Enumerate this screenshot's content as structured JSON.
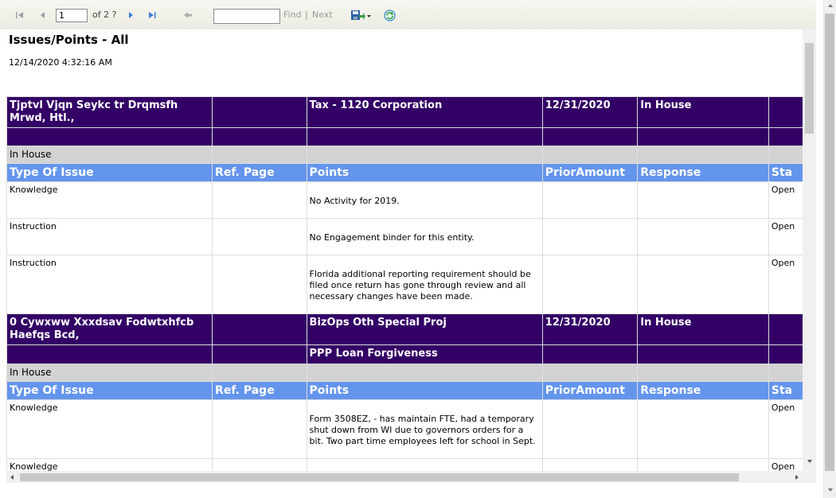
{
  "toolbar": {
    "page_number": "1",
    "page_of": "of 2 ?",
    "find_value": "",
    "find_label": "Find",
    "separator": "|",
    "next_label": "Next"
  },
  "report": {
    "title": "Issues/Points - All",
    "timestamp": "12/14/2020 4:32:16 AM",
    "column_headers": [
      "Type Of Issue",
      "Ref. Page",
      "Points",
      "PriorAmount",
      "Response",
      "Sta"
    ],
    "groups": [
      {
        "client": "Tjptvl Vjqn Seykc tr Drqmsfh Mrwd, Htl.,",
        "service": "Tax - 1120 Corporation",
        "date": "12/31/2020",
        "location": "In House",
        "sub_service": "",
        "status_band": "In House",
        "rows": [
          {
            "type": "Knowledge",
            "ref": "",
            "points": "No Activity for 2019.",
            "prior": "",
            "response": "",
            "status": "Open"
          },
          {
            "type": "Instruction",
            "ref": "",
            "points": "No Engagement binder for this entity.",
            "prior": "",
            "response": "",
            "status": "Open"
          },
          {
            "type": "Instruction",
            "ref": "",
            "points": "Florida additional reporting requirement should be filed once return has gone through review and all necessary changes have been made.",
            "prior": "",
            "response": "",
            "status": "Open"
          }
        ]
      },
      {
        "client": "0 Cywxww Xxxdsav Fodwtxhfcb Haefqs Bcd,",
        "service": "BizOps Oth Special Proj",
        "date": "12/31/2020",
        "location": "In House",
        "sub_service": "PPP Loan Forgiveness",
        "status_band": "In House",
        "rows": [
          {
            "type": "Knowledge",
            "ref": "",
            "points": "Form 3508EZ, - has maintain FTE, had a temporary shut down from WI due to governors orders for a bit. Two part time employees left for school in Sept.",
            "prior": "",
            "response": "",
            "status": "Open"
          },
          {
            "type": "Knowledge",
            "ref": "",
            "points": "",
            "prior": "",
            "response": "",
            "status": "Open"
          }
        ]
      }
    ]
  }
}
